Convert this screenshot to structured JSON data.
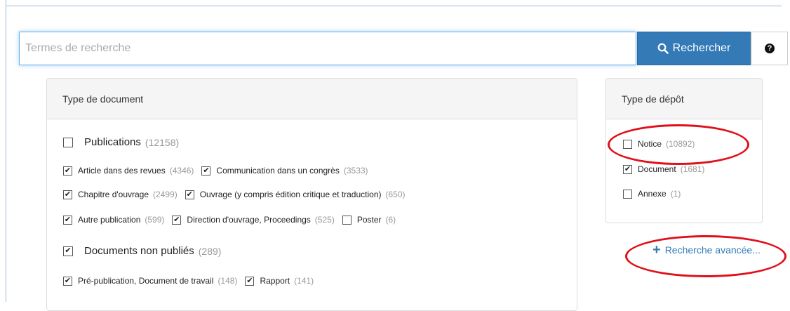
{
  "search": {
    "placeholder": "Termes de recherche",
    "value": "",
    "button_label": "Rechercher",
    "help_label": "?"
  },
  "document_type": {
    "title": "Type de document",
    "groups": [
      {
        "label": "Publications",
        "count": "(12158)",
        "checked": false,
        "items": [
          {
            "label": "Article dans des revues",
            "count": "(4346)",
            "checked": true
          },
          {
            "label": "Communication dans un congrès",
            "count": "(3533)",
            "checked": true
          },
          {
            "label": "Chapitre d'ouvrage",
            "count": "(2499)",
            "checked": true
          },
          {
            "label": "Ouvrage (y compris édition critique et traduction)",
            "count": "(650)",
            "checked": true
          },
          {
            "label": "Autre publication",
            "count": "(599)",
            "checked": true
          },
          {
            "label": "Direction d'ouvrage, Proceedings",
            "count": "(525)",
            "checked": true
          },
          {
            "label": "Poster",
            "count": "(6)",
            "checked": false
          }
        ]
      },
      {
        "label": "Documents non publiés",
        "count": "(289)",
        "checked": true,
        "items": [
          {
            "label": "Pré-publication, Document de travail",
            "count": "(148)",
            "checked": true
          },
          {
            "label": "Rapport",
            "count": "(141)",
            "checked": true
          }
        ]
      }
    ]
  },
  "deposit_type": {
    "title": "Type de dépôt",
    "items": [
      {
        "label": "Notice",
        "count": "(10892)",
        "checked": false
      },
      {
        "label": "Document",
        "count": "(1681)",
        "checked": true
      },
      {
        "label": "Annexe",
        "count": "(1)",
        "checked": false
      }
    ]
  },
  "advanced_search": {
    "label": "Recherche avancée..."
  },
  "colors": {
    "primary": "#337ab7",
    "annotation": "#e0101a"
  }
}
